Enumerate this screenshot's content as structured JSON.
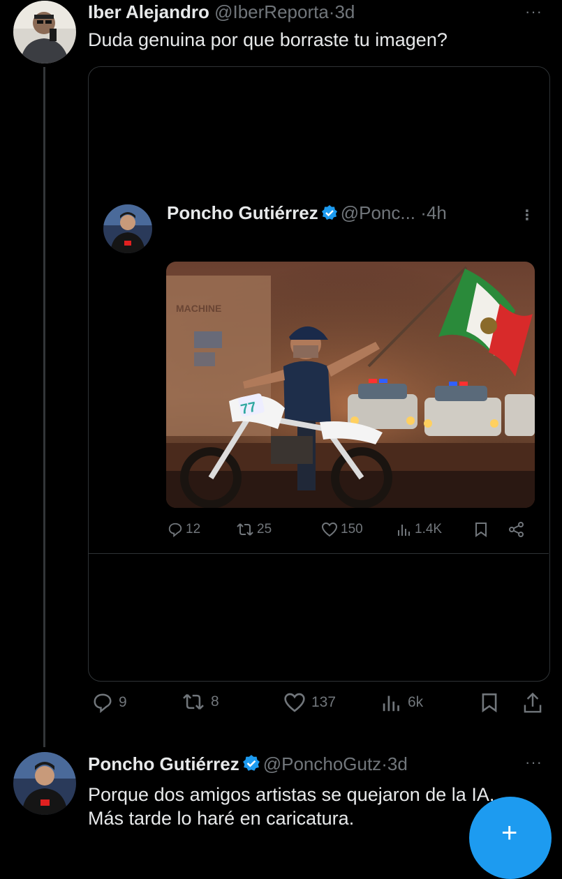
{
  "tweet": {
    "author_name": "Iber Alejandro",
    "handle": "@IberReporta",
    "time": "3d",
    "text": "Duda genuina por que borraste tu imagen?",
    "more": "···",
    "actions": {
      "replies": "9",
      "reposts": "8",
      "likes": "137",
      "views": "6k"
    }
  },
  "quoted": {
    "author_name": "Poncho Gutiérrez",
    "handle": "@Ponc...",
    "time": "4h",
    "more": "⋮",
    "image_text": "MACHINE",
    "bike_number": "77",
    "actions": {
      "replies": "12",
      "reposts": "25",
      "likes": "150",
      "views": "1.4K"
    }
  },
  "reply": {
    "author_name": "Poncho Gutiérrez",
    "handle": "@PonchoGutz",
    "time": "3d",
    "text": "Porque dos amigos artistas se quejaron de la IA. Más tarde lo haré en caricatura.",
    "more": "···"
  },
  "fab_label": "+",
  "colors": {
    "background": "#000000",
    "text": "#e7e9ea",
    "muted": "#71767b",
    "accent": "#1d9bf0",
    "border": "#2f3336"
  }
}
